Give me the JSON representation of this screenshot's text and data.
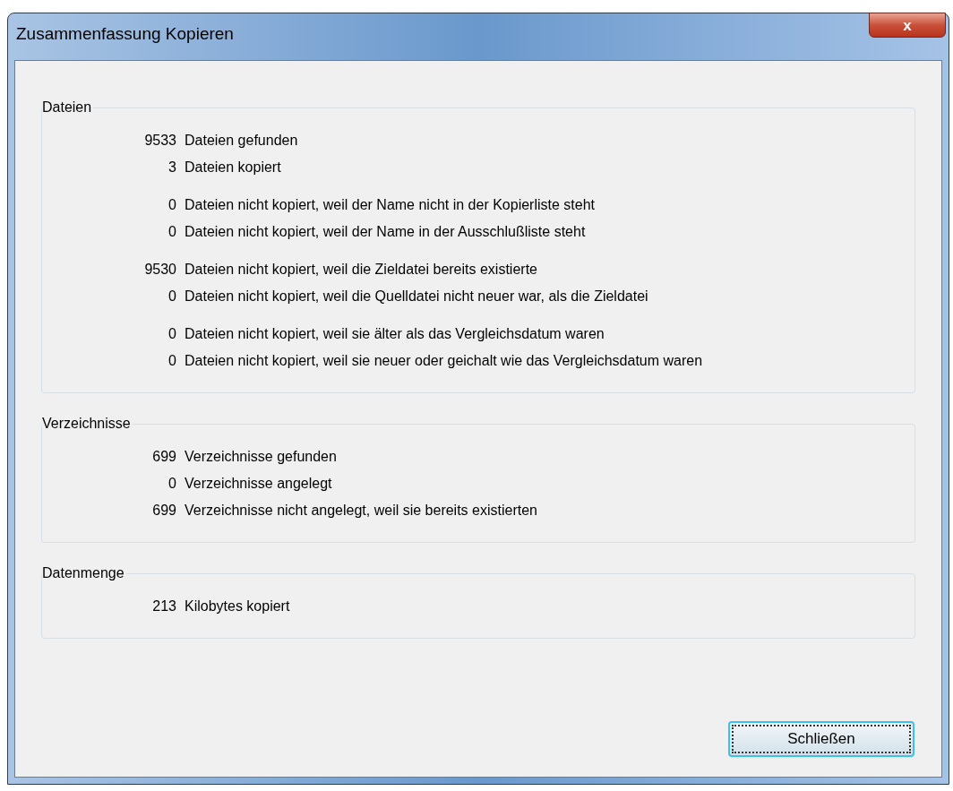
{
  "window": {
    "title": "Zusammenfassung Kopieren",
    "close": "x"
  },
  "groups": [
    {
      "title": "Dateien",
      "sections": [
        [
          {
            "count": "9533",
            "text": "Dateien gefunden"
          },
          {
            "count": "3",
            "text": "Dateien kopiert"
          }
        ],
        [
          {
            "count": "0",
            "text": "Dateien nicht kopiert, weil der Name nicht in der Kopierliste steht"
          },
          {
            "count": "0",
            "text": "Dateien nicht kopiert, weil der Name in der Ausschlußliste steht"
          }
        ],
        [
          {
            "count": "9530",
            "text": "Dateien nicht kopiert, weil die Zieldatei bereits existierte"
          },
          {
            "count": "0",
            "text": "Dateien nicht kopiert, weil die Quelldatei nicht neuer war, als die Zieldatei"
          }
        ],
        [
          {
            "count": "0",
            "text": "Dateien nicht kopiert, weil sie älter als das Vergleichsdatum waren"
          },
          {
            "count": "0",
            "text": "Dateien nicht kopiert, weil sie neuer oder geichalt wie das Vergleichsdatum waren"
          }
        ]
      ]
    },
    {
      "title": "Verzeichnisse",
      "sections": [
        [
          {
            "count": "699",
            "text": "Verzeichnisse gefunden"
          },
          {
            "count": "0",
            "text": "Verzeichnisse angelegt"
          },
          {
            "count": "699",
            "text": "Verzeichnisse nicht angelegt, weil sie bereits existierten"
          }
        ]
      ]
    },
    {
      "title": "Datenmenge",
      "sections": [
        [
          {
            "count": "213",
            "text": "Kilobytes kopiert"
          }
        ]
      ]
    }
  ],
  "button": {
    "label": "Schließen",
    "focused": true
  }
}
